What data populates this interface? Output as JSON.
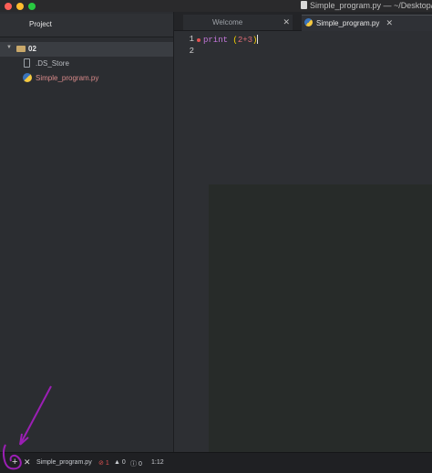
{
  "window": {
    "title": "Simple_program.py — ~/Desktop/"
  },
  "sidebar": {
    "tab_label": "Project",
    "tree": {
      "root": "02",
      "files": [
        ".DS_Store",
        "Simple_program.py"
      ]
    }
  },
  "tabs": [
    {
      "label": "Welcome",
      "close": "✕"
    },
    {
      "label": "Simple_program.py",
      "close": "✕"
    }
  ],
  "editor": {
    "line_numbers": [
      "1",
      "2"
    ],
    "code": {
      "kw": "print",
      "open": " (",
      "expr": "2+3",
      "close": ")"
    }
  },
  "status": {
    "add": "+",
    "close": "✕",
    "file": "Simple_program.py",
    "errors": "1",
    "warnings": "0",
    "infos": "0",
    "cursor": "1:12"
  },
  "colors": {
    "annotation": "#9b1fb4",
    "error": "#e05252"
  }
}
